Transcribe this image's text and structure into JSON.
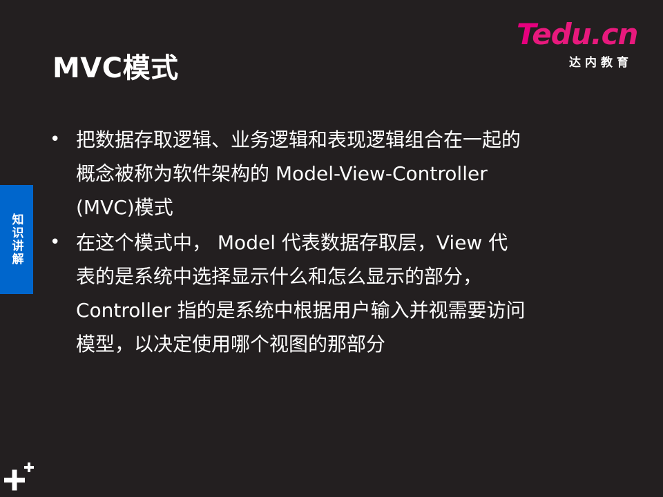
{
  "slide": {
    "title": "MVC模式",
    "logo": {
      "t": "T",
      "rest": "edu.cn",
      "subtitle": "达内教育"
    },
    "side_tab": {
      "label": "知识讲解"
    },
    "bullet_symbol": "•",
    "bullets": [
      {
        "lines": [
          "把数据存取逻辑、业务逻辑和表现逻辑组合在一起的",
          "概念被称为软件架构的 Model-View-Controller",
          "(MVC)模式"
        ]
      },
      {
        "lines": [
          "在这个模式中， Model 代表数据存取层，View 代",
          "表的是系统中选择显示什么和怎么显示的部分，",
          "Controller 指的是系统中根据用户输入并视需要访问",
          "模型，以决定使用哪个视图的那部分"
        ]
      }
    ],
    "icons": {
      "bottom_left": "plus-icon"
    },
    "colors": {
      "background": "#231f20",
      "text": "#ffffff",
      "side_tab": "#0066cc",
      "logo_accent": "#e6007e"
    }
  }
}
